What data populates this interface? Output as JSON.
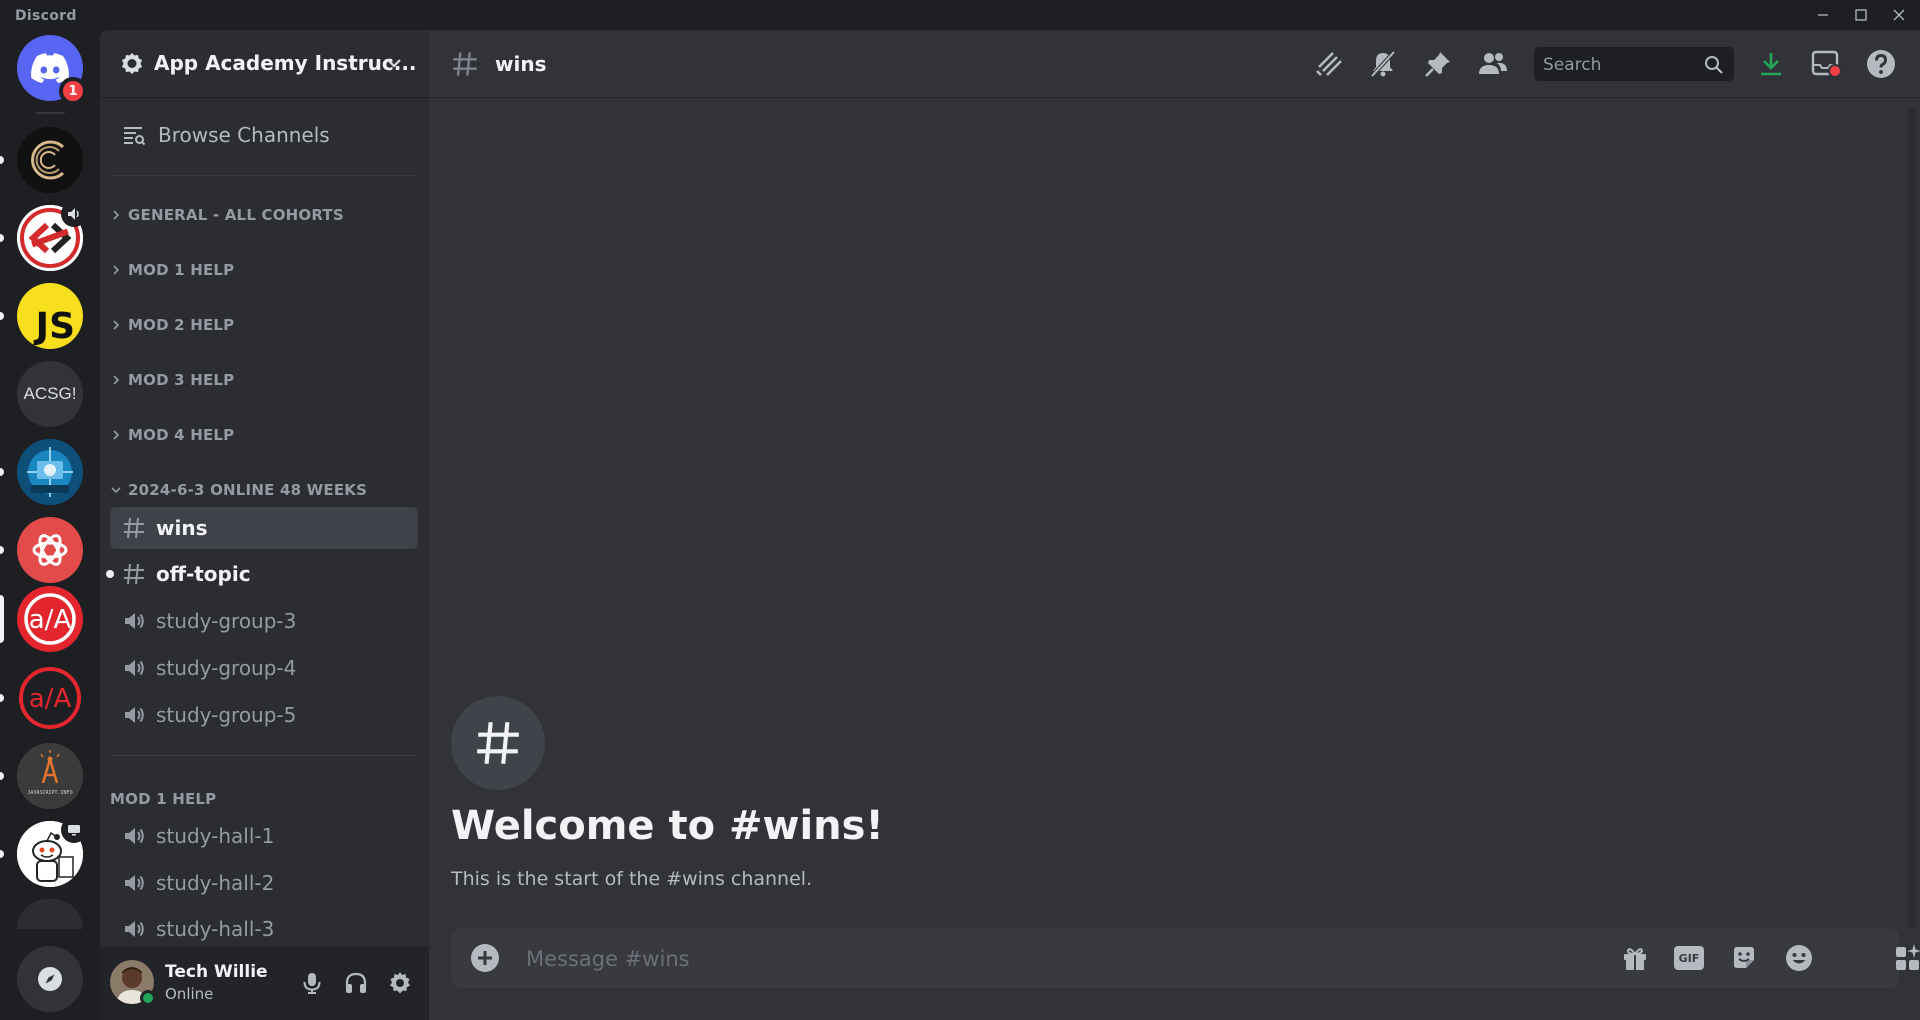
{
  "app": {
    "title": "Discord"
  },
  "server_rail": {
    "home_badge": "1",
    "acsg_label": "ACSG!",
    "js_label": "JS",
    "javascript_info_label": "JAVASCRIPT.INFO"
  },
  "sidebar": {
    "guild_name": "App Academy Instruc...",
    "browse_label": "Browse Channels",
    "categories": [
      {
        "label": "GENERAL - ALL COHORTS"
      },
      {
        "label": "MOD 1 HELP"
      },
      {
        "label": "MOD 2 HELP"
      },
      {
        "label": "MOD 3 HELP"
      },
      {
        "label": "MOD 4 HELP"
      },
      {
        "label": "2024-6-3 ONLINE 48 WEEKS"
      },
      {
        "label": "MOD 1 HELP"
      }
    ],
    "channels": [
      {
        "name": "wins",
        "type": "text"
      },
      {
        "name": "off-topic",
        "type": "text"
      },
      {
        "name": "study-group-3",
        "type": "stage"
      },
      {
        "name": "study-group-4",
        "type": "stage"
      },
      {
        "name": "study-group-5",
        "type": "stage"
      },
      {
        "name": "study-hall-1",
        "type": "stage"
      },
      {
        "name": "study-hall-2",
        "type": "stage"
      },
      {
        "name": "study-hall-3",
        "type": "stage"
      }
    ]
  },
  "user": {
    "name": "Tech Willie",
    "status": "Online"
  },
  "channel_header": {
    "name": "wins",
    "search_placeholder": "Search"
  },
  "welcome": {
    "title": "Welcome to #wins!",
    "subtitle": "This is the start of the #wins channel."
  },
  "composer": {
    "placeholder": "Message #wins",
    "gif_label": "GIF"
  },
  "colors": {
    "accent": "#5865f2",
    "online": "#23a55a",
    "danger": "#f23f43",
    "download": "#23a55a"
  }
}
